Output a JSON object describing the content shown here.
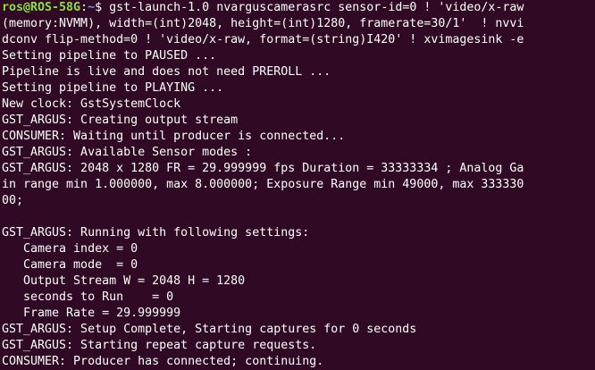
{
  "colors": {
    "background": "#300a24",
    "foreground": "#ffffff",
    "prompt_user": "#8ae234",
    "prompt_path": "#729fcf"
  },
  "prompt": {
    "user_host": "ros@ROS-58G",
    "separator": ":",
    "path": "~",
    "symbol": "$ ",
    "command_first_line": "gst-launch-1.0 nvarguscamerasrc sensor-id=0 ! 'video/x-raw"
  },
  "lines": [
    "(memory:NVMM), width=(int)2048, height=(int)1280, framerate=30/1'  ! nvvi",
    "dconv flip-method=0 ! 'video/x-raw, format=(string)I420' ! xvimagesink -e",
    "Setting pipeline to PAUSED ...",
    "Pipeline is live and does not need PREROLL ...",
    "Setting pipeline to PLAYING ...",
    "New clock: GstSystemClock",
    "GST_ARGUS: Creating output stream",
    "CONSUMER: Waiting until producer is connected...",
    "GST_ARGUS: Available Sensor modes :",
    "GST_ARGUS: 2048 x 1280 FR = 29.999999 fps Duration = 33333334 ; Analog Ga",
    "in range min 1.000000, max 8.000000; Exposure Range min 49000, max 333330",
    "00;",
    "",
    "GST_ARGUS: Running with following settings:",
    "   Camera index = 0",
    "   Camera mode  = 0",
    "   Output Stream W = 2048 H = 1280",
    "   seconds to Run    = 0",
    "   Frame Rate = 29.999999",
    "GST_ARGUS: Setup Complete, Starting captures for 0 seconds",
    "GST_ARGUS: Starting repeat capture requests.",
    "CONSUMER: Producer has connected; continuing."
  ]
}
